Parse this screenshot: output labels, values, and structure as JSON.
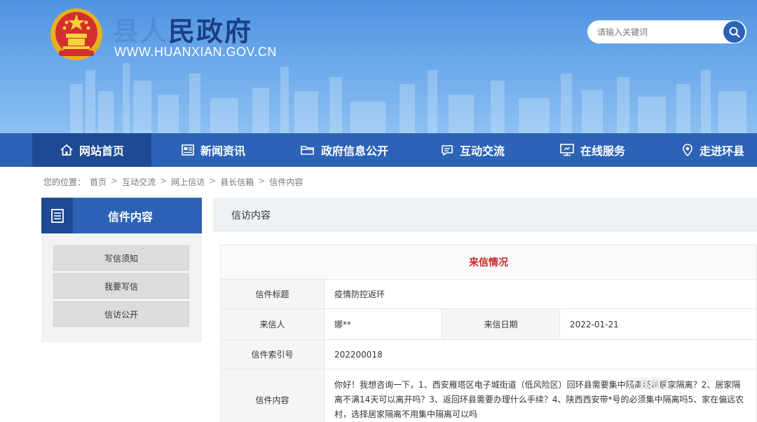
{
  "header": {
    "title": "民政府",
    "title_faded": "县人",
    "url": "WWW.HUANXIAN.GOV.CN",
    "search_placeholder": "请输入关键词"
  },
  "nav": [
    {
      "label": "网站首页",
      "icon": "home-icon"
    },
    {
      "label": "新闻资讯",
      "icon": "news-icon"
    },
    {
      "label": "政府信息公开",
      "icon": "folder-icon"
    },
    {
      "label": "互动交流",
      "icon": "chat-icon"
    },
    {
      "label": "在线服务",
      "icon": "monitor-icon"
    },
    {
      "label": "走进环县",
      "icon": "location-icon"
    }
  ],
  "breadcrumb": {
    "prefix": "您的位置：",
    "items": [
      "首页",
      "互动交流",
      "网上信访",
      "县长信箱",
      "信件内容"
    ],
    "separator": ">"
  },
  "sidebar": {
    "title": "信件内容",
    "items": [
      "写信须知",
      "我要写信",
      "信访公开"
    ]
  },
  "main": {
    "title": "信访内容",
    "table_caption": "来信情况",
    "labels": {
      "subject": "信件标题",
      "sender": "来信人",
      "date": "来信日期",
      "index": "信件索引号",
      "content": "信件内容"
    },
    "values": {
      "subject": "疫情防控返环",
      "sender": "娜**",
      "date": "2022-01-21",
      "index": "202200018",
      "content": "你好！我想咨询一下，1、西安雁塔区电子城街道（低风险区）回环县需要集中隔离还是居家隔离？2、居家隔离不满14天可以离开吗？3、返回环县需要办理什么手续？4、陕西西安带*号的必须集中隔离吗5、家在偏远农村，选择居家隔离不用集中隔离可以吗"
    }
  },
  "watermark": "环县圈子",
  "colors": {
    "header_blue": "#4f93e0",
    "nav_blue": "#2c63b7",
    "nav_active": "#1d4a93",
    "caption_red": "#c62828"
  }
}
